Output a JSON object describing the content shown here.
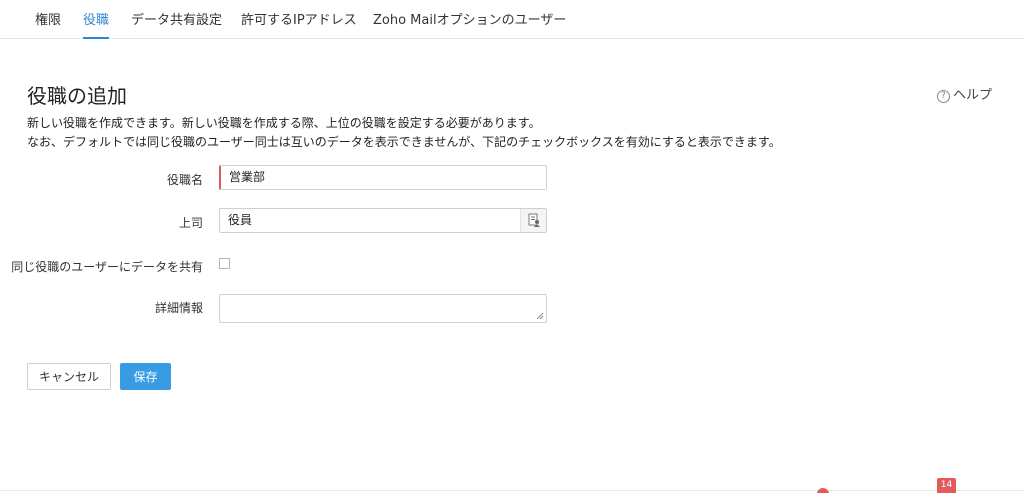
{
  "tabs": [
    {
      "label": "権限"
    },
    {
      "label": "役職"
    },
    {
      "label": "データ共有設定"
    },
    {
      "label": "許可するIPアドレス"
    },
    {
      "label": "Zoho Mailオプションのユーザー"
    }
  ],
  "header": {
    "title": "役職の追加",
    "help_label": "ヘルプ",
    "help_icon": "question-circle-icon",
    "description_line1": "新しい役職を作成できます。新しい役職を作成する際、上位の役職を設定する必要があります。",
    "description_line2": "なお、デフォルトでは同じ役職のユーザー同士は互いのデータを表示できませんが、下記のチェックボックスを有効にすると表示できます。"
  },
  "form": {
    "role_name_label": "役職名",
    "role_name_value": "営業部",
    "superior_label": "上司",
    "superior_value": "役員",
    "share_label": "同じ役職のユーザーにデータを共有",
    "share_checked": false,
    "details_label": "詳細情報",
    "details_value": ""
  },
  "buttons": {
    "cancel": "キャンセル",
    "save": "保存"
  },
  "footer": {
    "badge_count": "14"
  },
  "colors": {
    "accent": "#2f86d6",
    "primary_button": "#3a9be5",
    "required_marker": "#e05a5a",
    "badge": "#e25c5c"
  }
}
